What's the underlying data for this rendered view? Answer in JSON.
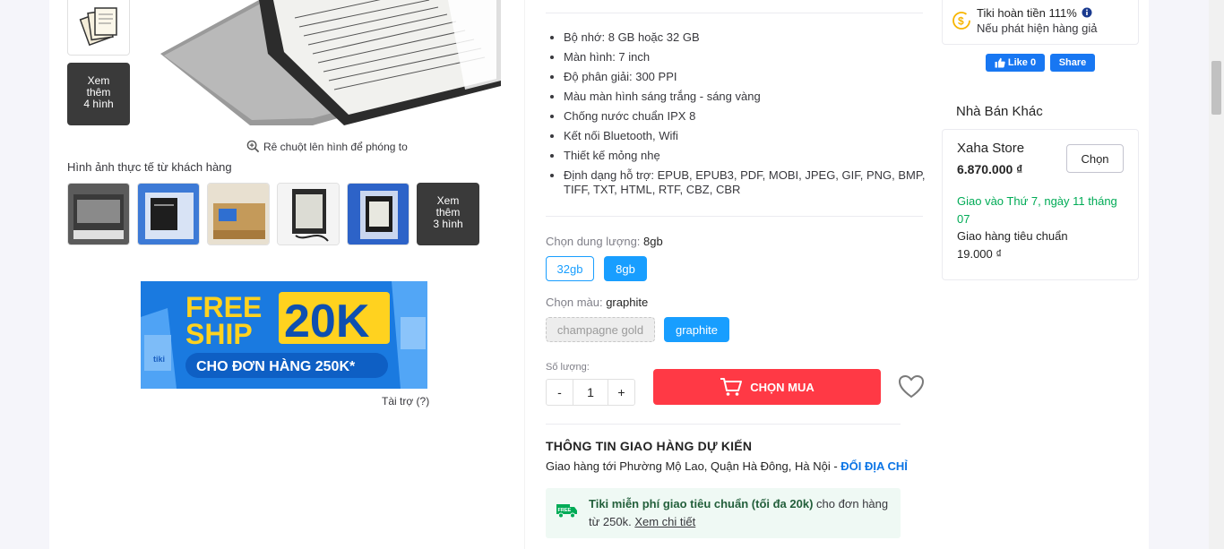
{
  "gallery": {
    "more_main": [
      "Xem",
      "thêm",
      "4 hình"
    ],
    "zoom_hint": "Rê chuột lên hình để phóng to",
    "customer_title": "Hình ảnh thực tế từ khách hàng",
    "more_customer": [
      "Xem",
      "thêm",
      "3 hình"
    ]
  },
  "banner": {
    "free": "FREE",
    "ship": "SHIP",
    "amount": "20K",
    "sub": "CHO ĐƠN HÀNG 250K*",
    "brand": "tiki",
    "sponsor": "Tài trợ (?)"
  },
  "specs": [
    "Bộ nhớ: 8 GB hoặc 32 GB",
    "Màn hình: 7 inch",
    "Độ phân giải: 300 PPI",
    "Màu màn hình sáng trắng - sáng vàng",
    "Chống nước chuẩn IPX 8",
    "Kết nối Bluetooth, Wifi",
    "Thiết kế mỏng nhẹ",
    "Định dạng hỗ trợ: EPUB, EPUB3, PDF, MOBI, JPEG, GIF, PNG, BMP, TIFF, TXT, HTML, RTF, CBZ, CBR"
  ],
  "capacity": {
    "label": "Chọn dung lượng: ",
    "selected": "8gb",
    "options": [
      "32gb",
      "8gb"
    ]
  },
  "color": {
    "label": "Chọn màu: ",
    "selected": "graphite",
    "options": [
      "champagne gold",
      "graphite"
    ]
  },
  "quantity": {
    "label": "Số lượng:",
    "minus": "-",
    "value": "1",
    "plus": "+"
  },
  "buy_label": "CHỌN MUA",
  "shipping": {
    "title": "THÔNG TIN GIAO HÀNG DỰ KIẾN",
    "address": "Giao hàng tới Phường Mộ Lao, Quận Hà Đông, Hà Nội - ",
    "change": "ĐỔI ĐỊA CHỈ",
    "free_bold": "Tiki miễn phí giao tiêu chuẩn (tối đa 20k)",
    "free_rest": " cho đơn hàng từ 250k. ",
    "free_link": "Xem chi tiết",
    "free_icon_text": "FREE"
  },
  "refund": {
    "line1": "Tiki hoàn tiền 111%",
    "line2": "Nếu phát hiện hàng giả"
  },
  "facebook": {
    "like": "Like 0",
    "share": "Share"
  },
  "other_sellers": {
    "title": "Nhà Bán Khác",
    "name": "Xaha Store",
    "price": "6.870.000 ₫",
    "pick": "Chọn",
    "delivery": "Giao vào Thứ 7, ngày 11 tháng 07",
    "standard": "Giao hàng tiêu chuẩn",
    "fee": "19.000 ₫"
  },
  "colors": {
    "primary_blue": "#0b74e5",
    "button_blue": "#189eff",
    "buy_red": "#ff3945",
    "green": "#00ab56"
  }
}
